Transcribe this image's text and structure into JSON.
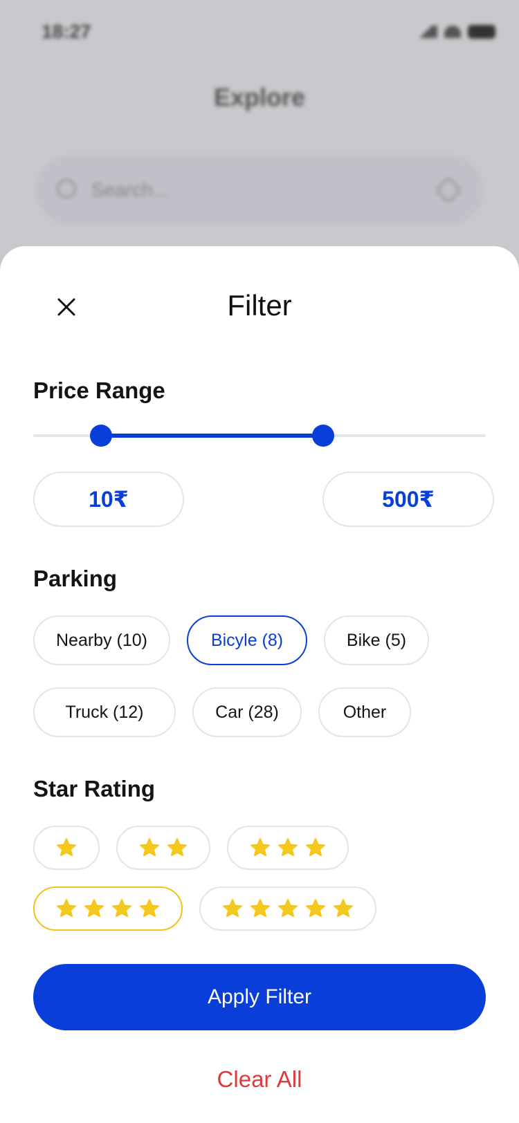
{
  "status_bar": {
    "time": "18:27"
  },
  "background": {
    "title": "Explore",
    "search_placeholder": "Search..."
  },
  "sheet": {
    "title": "Filter",
    "price_range": {
      "title": "Price Range",
      "min_value": "10₹",
      "max_value": "500₹",
      "slider_low_fraction": 0.15,
      "slider_high_fraction": 0.64
    },
    "parking": {
      "title": "Parking",
      "options": [
        {
          "label": "Nearby (10)",
          "selected": false
        },
        {
          "label": "Bicyle (8)",
          "selected": true
        },
        {
          "label": "Bike (5)",
          "selected": false
        },
        {
          "label": "Truck (12)",
          "selected": false
        },
        {
          "label": "Car (28)",
          "selected": false
        },
        {
          "label": "Other",
          "selected": false
        }
      ]
    },
    "star_rating": {
      "title": "Star Rating",
      "options": [
        {
          "stars": 1,
          "selected": false
        },
        {
          "stars": 2,
          "selected": false
        },
        {
          "stars": 3,
          "selected": false
        },
        {
          "stars": 4,
          "selected": true
        },
        {
          "stars": 5,
          "selected": false
        }
      ]
    },
    "apply_label": "Apply Filter",
    "clear_label": "Clear All"
  },
  "colors": {
    "accent": "#0a3ed8",
    "star": "#f7c81c",
    "danger": "#e0393c"
  },
  "icons": {
    "close": "close-icon",
    "star": "star-icon",
    "search": "search-icon",
    "filter": "filter-icon"
  }
}
